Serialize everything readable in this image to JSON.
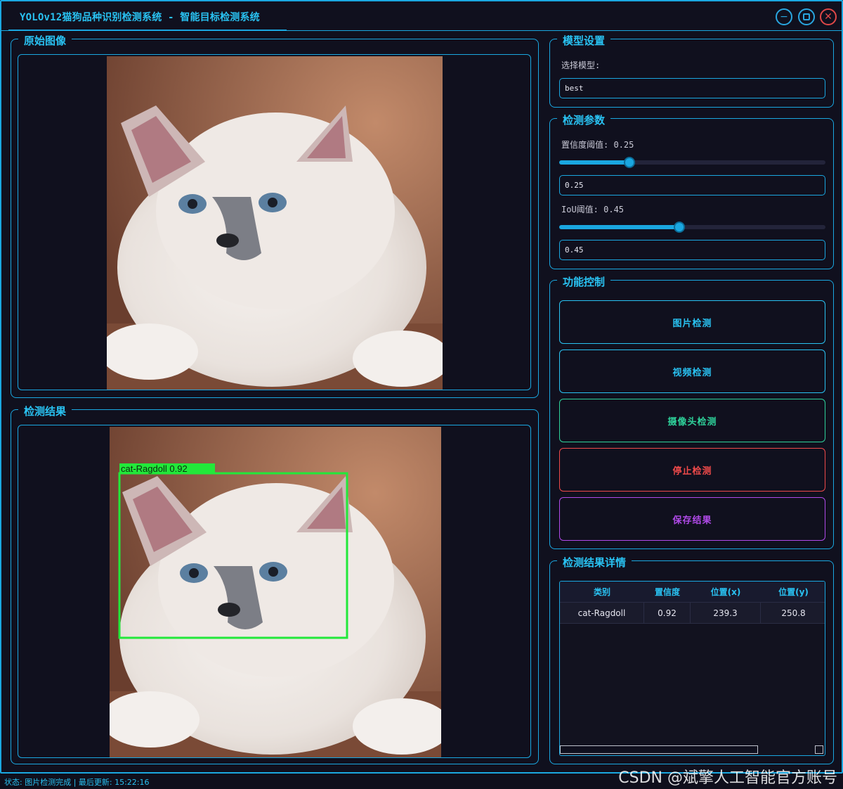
{
  "window": {
    "title": "YOLOv12猫狗品种识别检测系统 - 智能目标检测系统",
    "minimize_icon": "minimize-icon",
    "maximize_icon": "maximize-icon",
    "close_icon": "close-icon"
  },
  "original_image": {
    "title": "原始图像"
  },
  "detection_result": {
    "title": "检测结果",
    "box_label": "cat-Ragdoll 0.92",
    "box_color": "#22e83a"
  },
  "model_settings": {
    "title": "模型设置",
    "select_label": "选择模型:",
    "selected_model": "best"
  },
  "detection_params": {
    "title": "检测参数",
    "confidence_label": "置信度阈值: 0.25",
    "confidence_value": "0.25",
    "confidence_fraction": 0.25,
    "iou_label": "IoU阈值: 0.45",
    "iou_value": "0.45",
    "iou_fraction": 0.45
  },
  "function_control": {
    "title": "功能控制",
    "buttons": [
      {
        "label": "图片检测",
        "color": "#29c2f2"
      },
      {
        "label": "视频检测",
        "color": "#29c2f2"
      },
      {
        "label": "摄像头检测",
        "color": "#2ed19a"
      },
      {
        "label": "停止检测",
        "color": "#ef4a4a"
      },
      {
        "label": "保存结果",
        "color": "#b04ae8"
      }
    ]
  },
  "result_details": {
    "title": "检测结果详情",
    "columns": [
      "类别",
      "置信度",
      "位置(x)",
      "位置(y)"
    ],
    "rows": [
      [
        "cat-Ragdoll",
        "0.92",
        "239.3",
        "250.8"
      ]
    ]
  },
  "status_bar": {
    "text": "状态: 图片检测完成 | 最后更新: 15:22:16"
  },
  "watermark": "CSDN @斌擎人工智能官方账号",
  "colors": {
    "accent": "#1aa7e0",
    "background": "#10101e"
  }
}
